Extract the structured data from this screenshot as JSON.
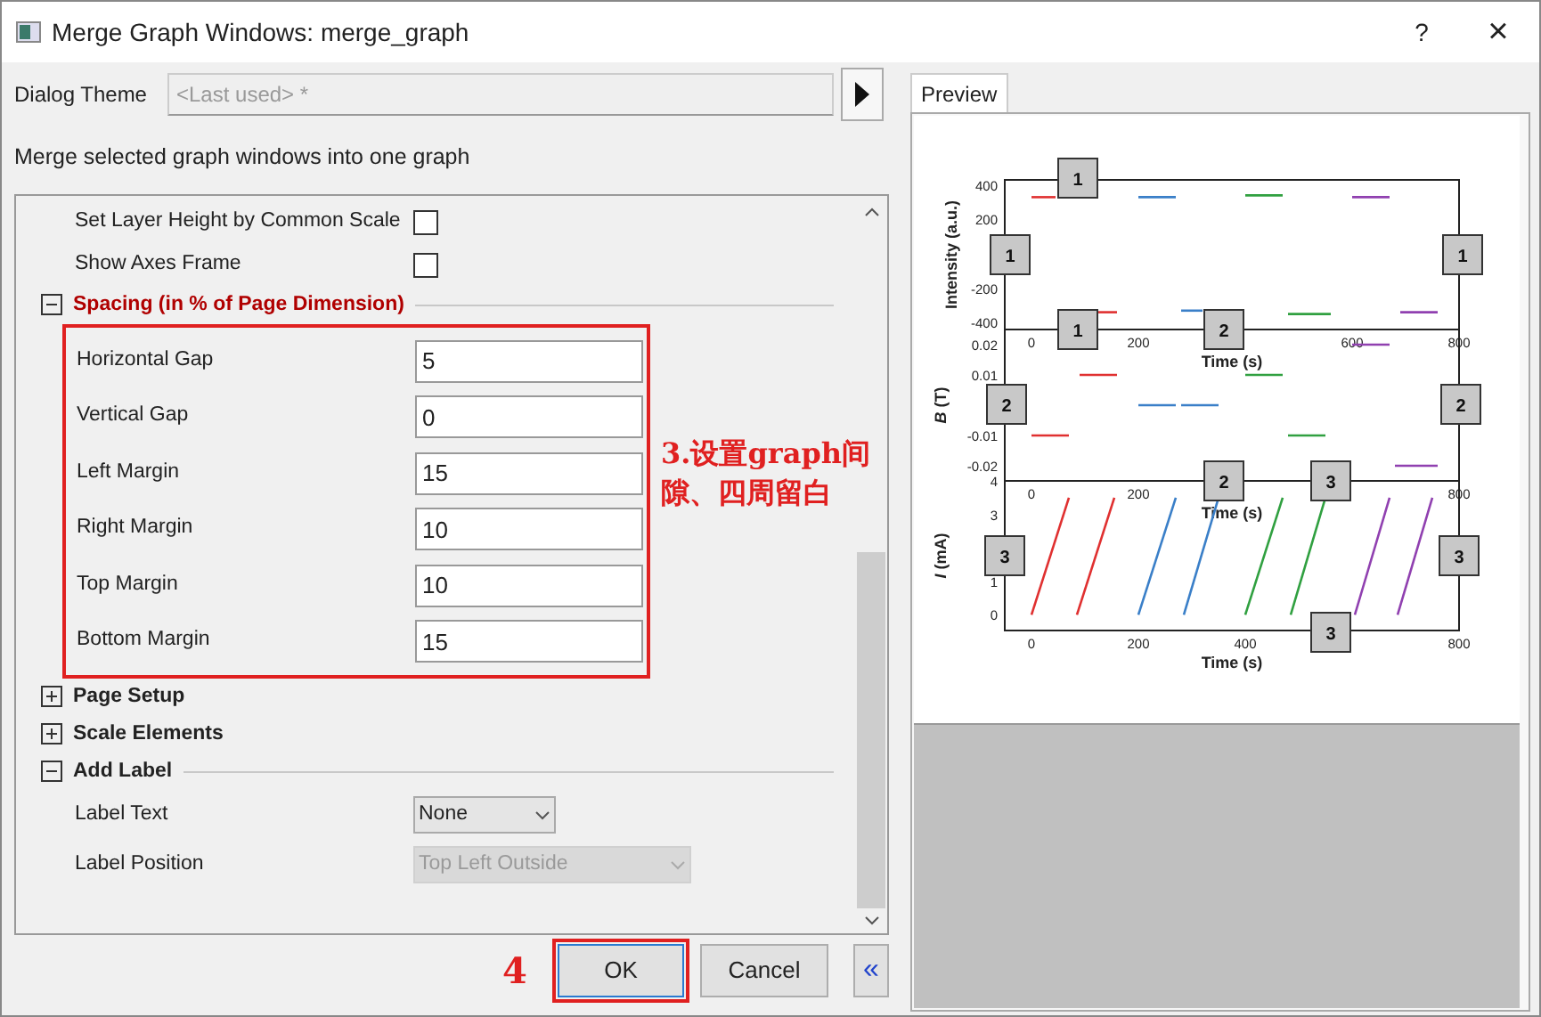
{
  "window": {
    "title": "Merge Graph Windows: merge_graph",
    "help": "?",
    "close": "×"
  },
  "dialog_theme": {
    "label": "Dialog Theme",
    "placeholder": "<Last used> *"
  },
  "description": "Merge selected graph windows into one graph",
  "tree": [
    {
      "kind": "checkbox",
      "label": "Set Layer Height by Common Scale",
      "checked": false
    },
    {
      "kind": "checkbox",
      "label": "Show Axes Frame",
      "checked": false
    },
    {
      "kind": "section",
      "label": "Spacing (in % of Page Dimension)",
      "expanded": true,
      "annotated": true,
      "children": [
        {
          "kind": "number",
          "label": "Horizontal Gap",
          "value": "5"
        },
        {
          "kind": "number",
          "label": "Vertical Gap",
          "value": "0"
        },
        {
          "kind": "number",
          "label": "Left Margin",
          "value": "15"
        },
        {
          "kind": "number",
          "label": "Right Margin",
          "value": "10"
        },
        {
          "kind": "number",
          "label": "Top Margin",
          "value": "10"
        },
        {
          "kind": "number",
          "label": "Bottom Margin",
          "value": "15"
        }
      ]
    },
    {
      "kind": "section",
      "label": "Page Setup",
      "expanded": false,
      "annotated": false
    },
    {
      "kind": "section",
      "label": "Scale Elements",
      "expanded": false,
      "annotated": false
    },
    {
      "kind": "section",
      "label": "Add Label",
      "expanded": true,
      "annotated": false,
      "children": [
        {
          "kind": "dropdown",
          "label": "Label Text",
          "value": "None",
          "disabled": false
        },
        {
          "kind": "dropdown",
          "label": "Label Position",
          "value": "Top Left Outside",
          "disabled": true
        }
      ]
    }
  ],
  "annotations": {
    "spacing_note": "3.设置graph间隙、四周留白",
    "ok_note": "4"
  },
  "preview": {
    "tab": "Preview",
    "selected": true,
    "charts": [
      {
        "chart_data": {
          "type": "line",
          "ylabel": "Intensity (a.u.)",
          "xlabel": "Time (s)",
          "xlim": [
            -50,
            800
          ],
          "ylim": [
            -440,
            430
          ],
          "xticks": [
            0,
            200,
            600,
            800
          ],
          "yticks": [
            400,
            200,
            -200,
            -400
          ],
          "x": [
            0,
            45,
            125,
            160,
            200,
            270,
            280,
            320,
            400,
            470,
            480,
            560,
            600,
            670,
            690,
            760
          ],
          "series": [
            {
              "color": "#e03030",
              "values": [
                330,
                330,
                null,
                null,
                null,
                null,
                null,
                null,
                null,
                null,
                null,
                null,
                null,
                null,
                null,
                null
              ]
            },
            {
              "color": "#e03030",
              "values": [
                null,
                null,
                -340,
                -340,
                null,
                null,
                null,
                null,
                null,
                null,
                null,
                null,
                null,
                null,
                null,
                null
              ]
            },
            {
              "color": "#3a7fc8",
              "values": [
                null,
                null,
                null,
                null,
                330,
                330,
                null,
                null,
                null,
                null,
                null,
                null,
                null,
                null,
                null,
                null
              ]
            },
            {
              "color": "#3a7fc8",
              "values": [
                null,
                null,
                null,
                null,
                null,
                null,
                -330,
                -330,
                null,
                null,
                null,
                null,
                null,
                null,
                null,
                null
              ]
            },
            {
              "color": "#30a040",
              "values": [
                null,
                null,
                null,
                null,
                null,
                null,
                null,
                null,
                340,
                340,
                null,
                null,
                null,
                null,
                null,
                null
              ]
            },
            {
              "color": "#30a040",
              "values": [
                null,
                null,
                null,
                null,
                null,
                null,
                null,
                null,
                null,
                null,
                -350,
                -350,
                null,
                null,
                null,
                null
              ]
            },
            {
              "color": "#9040b0",
              "values": [
                null,
                null,
                null,
                null,
                null,
                null,
                null,
                null,
                null,
                null,
                null,
                null,
                330,
                330,
                null,
                null
              ]
            },
            {
              "color": "#9040b0",
              "values": [
                null,
                null,
                null,
                null,
                null,
                null,
                null,
                null,
                null,
                null,
                null,
                null,
                null,
                null,
                -340,
                -340
              ]
            }
          ]
        }
      },
      {
        "chart_data": {
          "type": "line",
          "ylabel": "*B* (T)",
          "xlabel": "Time (s)",
          "xlim": [
            -50,
            800
          ],
          "ylim": [
            -0.025,
            0.025
          ],
          "xticks": [
            0,
            200,
            800
          ],
          "yticks": [
            0.02,
            0.01,
            -0.01,
            -0.02
          ],
          "x": [
            0,
            70,
            90,
            160,
            200,
            270,
            280,
            350,
            400,
            470,
            480,
            550,
            600,
            670,
            680,
            760
          ],
          "series": [
            {
              "color": "#e03030",
              "values": [
                -0.01,
                -0.01,
                null,
                null,
                null,
                null,
                null,
                null,
                null,
                null,
                null,
                null,
                null,
                null,
                null,
                null
              ]
            },
            {
              "color": "#e03030",
              "values": [
                null,
                null,
                0.01,
                0.01,
                null,
                null,
                null,
                null,
                null,
                null,
                null,
                null,
                null,
                null,
                null,
                null
              ]
            },
            {
              "color": "#3a7fc8",
              "values": [
                null,
                null,
                null,
                null,
                0,
                0,
                null,
                null,
                null,
                null,
                null,
                null,
                null,
                null,
                null,
                null
              ]
            },
            {
              "color": "#3a7fc8",
              "values": [
                null,
                null,
                null,
                null,
                null,
                null,
                0,
                0,
                null,
                null,
                null,
                null,
                null,
                null,
                null,
                null
              ]
            },
            {
              "color": "#30a040",
              "values": [
                null,
                null,
                null,
                null,
                null,
                null,
                null,
                null,
                0.01,
                0.01,
                null,
                null,
                null,
                null,
                null,
                null
              ]
            },
            {
              "color": "#30a040",
              "values": [
                null,
                null,
                null,
                null,
                null,
                null,
                null,
                null,
                null,
                null,
                -0.01,
                -0.01,
                null,
                null,
                null,
                null
              ]
            },
            {
              "color": "#9040b0",
              "values": [
                null,
                null,
                null,
                null,
                null,
                null,
                null,
                null,
                null,
                null,
                null,
                null,
                0.02,
                0.02,
                null,
                null
              ]
            },
            {
              "color": "#9040b0",
              "values": [
                null,
                null,
                null,
                null,
                null,
                null,
                null,
                null,
                null,
                null,
                null,
                null,
                null,
                null,
                -0.02,
                -0.02
              ]
            }
          ]
        }
      },
      {
        "chart_data": {
          "type": "line",
          "ylabel": "*I* (mA)",
          "xlabel": "Time (s)",
          "xlim": [
            -50,
            800
          ],
          "ylim": [
            -0.47,
            4
          ],
          "xticks": [
            0,
            200,
            400,
            800
          ],
          "yticks": [
            4,
            3,
            1,
            0
          ],
          "x": [
            0,
            70,
            85,
            155,
            200,
            270,
            285,
            350,
            400,
            470,
            485,
            550,
            605,
            670,
            685,
            750
          ],
          "series": [
            {
              "color": "#e03030",
              "values": [
                0,
                3.5,
                null,
                null,
                null,
                null,
                null,
                null,
                null,
                null,
                null,
                null,
                null,
                null,
                null,
                null
              ]
            },
            {
              "color": "#e03030",
              "values": [
                null,
                null,
                0,
                3.5,
                null,
                null,
                null,
                null,
                null,
                null,
                null,
                null,
                null,
                null,
                null,
                null
              ]
            },
            {
              "color": "#3a7fc8",
              "values": [
                null,
                null,
                null,
                null,
                0,
                3.5,
                null,
                null,
                null,
                null,
                null,
                null,
                null,
                null,
                null,
                null
              ]
            },
            {
              "color": "#3a7fc8",
              "values": [
                null,
                null,
                null,
                null,
                null,
                null,
                0,
                3.5,
                null,
                null,
                null,
                null,
                null,
                null,
                null,
                null
              ]
            },
            {
              "color": "#30a040",
              "values": [
                null,
                null,
                null,
                null,
                null,
                null,
                null,
                null,
                0,
                3.5,
                null,
                null,
                null,
                null,
                null,
                null
              ]
            },
            {
              "color": "#30a040",
              "values": [
                null,
                null,
                null,
                null,
                null,
                null,
                null,
                null,
                null,
                null,
                0,
                3.5,
                null,
                null,
                null,
                null
              ]
            },
            {
              "color": "#9040b0",
              "values": [
                null,
                null,
                null,
                null,
                null,
                null,
                null,
                null,
                null,
                null,
                null,
                null,
                0,
                3.5,
                null,
                null
              ]
            },
            {
              "color": "#9040b0",
              "values": [
                null,
                null,
                null,
                null,
                null,
                null,
                null,
                null,
                null,
                null,
                null,
                null,
                null,
                null,
                0,
                3.5
              ]
            }
          ]
        }
      }
    ],
    "layer_badges": [
      "1",
      "1",
      "1",
      "1",
      "2",
      "2",
      "2",
      "2",
      "3",
      "3",
      "3",
      "3"
    ]
  },
  "buttons": [
    {
      "kind": "default",
      "label": "OK",
      "annotated": true
    },
    {
      "kind": "normal",
      "label": "Cancel",
      "annotated": false
    },
    {
      "kind": "toggle",
      "label": "«",
      "annotated": false
    }
  ]
}
